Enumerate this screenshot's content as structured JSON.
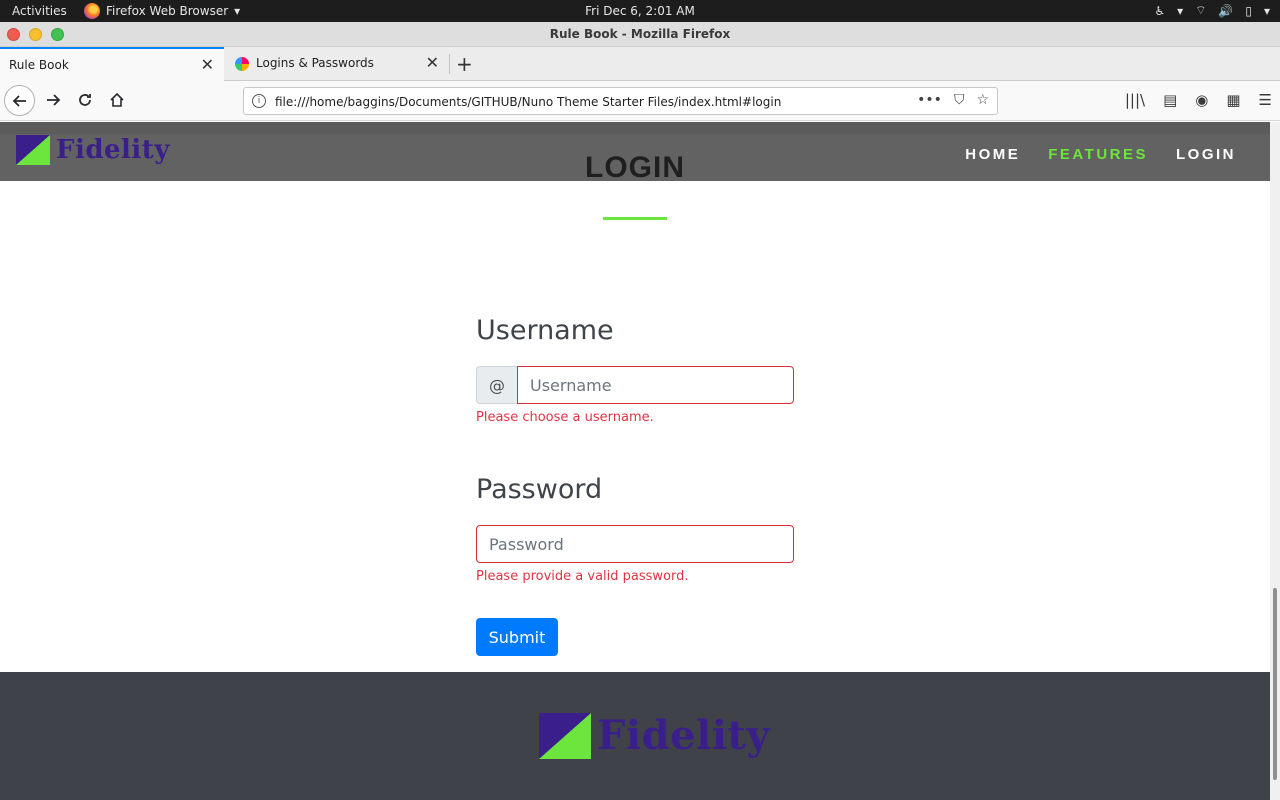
{
  "system_bar": {
    "activities": "Activities",
    "app_name": "Firefox Web Browser",
    "clock": "Fri Dec  6,  2:01 AM"
  },
  "window": {
    "title": "Rule Book - Mozilla Firefox"
  },
  "tabs": [
    {
      "label": "Rule Book",
      "active": true
    },
    {
      "label": "Logins & Passwords",
      "active": false
    }
  ],
  "address_bar": {
    "url": "file:///home/baggins/Documents/GITHUB/Nuno Theme Starter Files/index.html#login"
  },
  "site": {
    "brand": "Fidelity",
    "brand_colors": {
      "purple": "#3a1f8a",
      "green": "#6ce53c"
    },
    "nav": [
      {
        "label": "HOME",
        "current": false
      },
      {
        "label": "FEATURES",
        "current": true
      },
      {
        "label": "LOGIN",
        "current": false
      }
    ],
    "section_heading": "LOGIN"
  },
  "form": {
    "username_label": "Username",
    "username_prefix": "@",
    "username_placeholder": "Username",
    "username_error": "Please choose a username.",
    "password_label": "Password",
    "password_placeholder": "Password",
    "password_error": "Please provide a valid password.",
    "submit_label": "Submit"
  },
  "footer": {
    "brand": "Fidelity"
  }
}
